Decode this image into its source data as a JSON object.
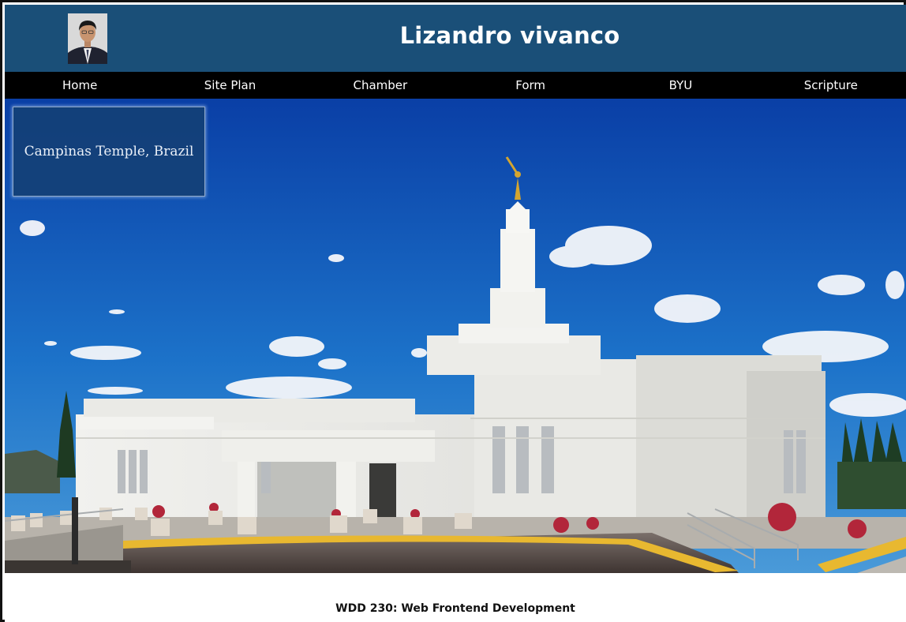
{
  "header": {
    "title": "Lizandro vivanco",
    "avatar_icon": "profile-photo"
  },
  "nav": {
    "items": [
      {
        "label": "Home"
      },
      {
        "label": "Site Plan"
      },
      {
        "label": "Chamber"
      },
      {
        "label": "Form"
      },
      {
        "label": "BYU"
      },
      {
        "label": "Scripture"
      }
    ]
  },
  "hero": {
    "caption": "Campinas Temple, Brazil"
  },
  "footer": {
    "text": "WDD 230: Web Frontend Development"
  },
  "colors": {
    "header_bg": "#1a4f78",
    "nav_bg": "#000000",
    "caption_bg": "#134076",
    "sky": "#1566c0"
  }
}
